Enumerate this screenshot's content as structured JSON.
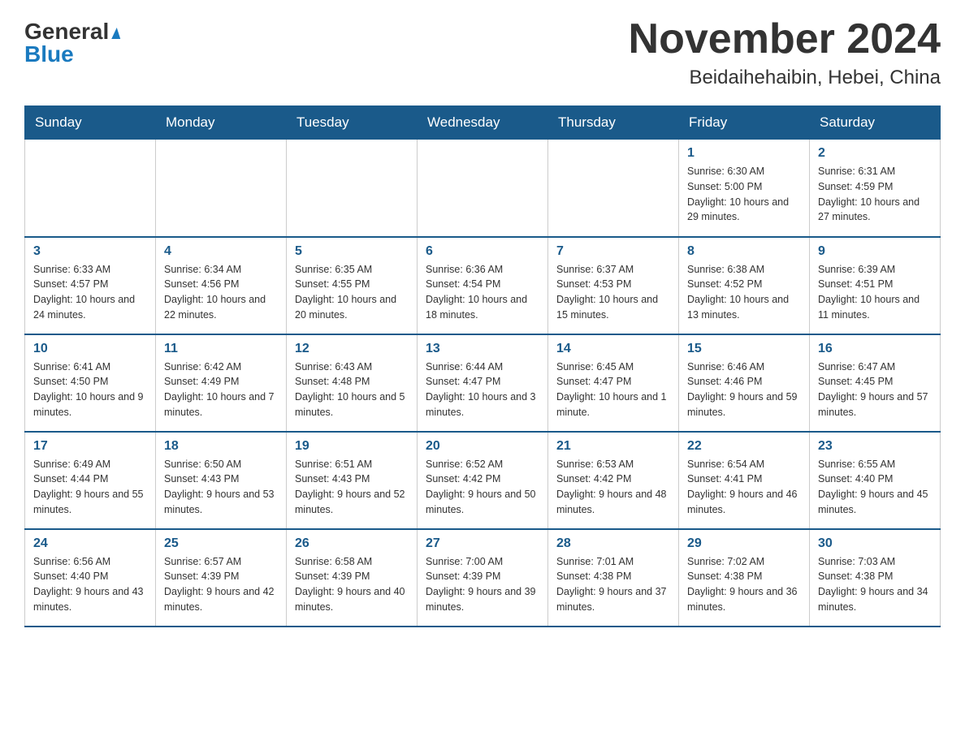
{
  "header": {
    "logo_general": "General",
    "logo_blue": "Blue",
    "month_title": "November 2024",
    "location": "Beidaihehaibin, Hebei, China"
  },
  "weekdays": [
    "Sunday",
    "Monday",
    "Tuesday",
    "Wednesday",
    "Thursday",
    "Friday",
    "Saturday"
  ],
  "weeks": [
    [
      {
        "day": "",
        "info": ""
      },
      {
        "day": "",
        "info": ""
      },
      {
        "day": "",
        "info": ""
      },
      {
        "day": "",
        "info": ""
      },
      {
        "day": "",
        "info": ""
      },
      {
        "day": "1",
        "info": "Sunrise: 6:30 AM\nSunset: 5:00 PM\nDaylight: 10 hours and 29 minutes."
      },
      {
        "day": "2",
        "info": "Sunrise: 6:31 AM\nSunset: 4:59 PM\nDaylight: 10 hours and 27 minutes."
      }
    ],
    [
      {
        "day": "3",
        "info": "Sunrise: 6:33 AM\nSunset: 4:57 PM\nDaylight: 10 hours and 24 minutes."
      },
      {
        "day": "4",
        "info": "Sunrise: 6:34 AM\nSunset: 4:56 PM\nDaylight: 10 hours and 22 minutes."
      },
      {
        "day": "5",
        "info": "Sunrise: 6:35 AM\nSunset: 4:55 PM\nDaylight: 10 hours and 20 minutes."
      },
      {
        "day": "6",
        "info": "Sunrise: 6:36 AM\nSunset: 4:54 PM\nDaylight: 10 hours and 18 minutes."
      },
      {
        "day": "7",
        "info": "Sunrise: 6:37 AM\nSunset: 4:53 PM\nDaylight: 10 hours and 15 minutes."
      },
      {
        "day": "8",
        "info": "Sunrise: 6:38 AM\nSunset: 4:52 PM\nDaylight: 10 hours and 13 minutes."
      },
      {
        "day": "9",
        "info": "Sunrise: 6:39 AM\nSunset: 4:51 PM\nDaylight: 10 hours and 11 minutes."
      }
    ],
    [
      {
        "day": "10",
        "info": "Sunrise: 6:41 AM\nSunset: 4:50 PM\nDaylight: 10 hours and 9 minutes."
      },
      {
        "day": "11",
        "info": "Sunrise: 6:42 AM\nSunset: 4:49 PM\nDaylight: 10 hours and 7 minutes."
      },
      {
        "day": "12",
        "info": "Sunrise: 6:43 AM\nSunset: 4:48 PM\nDaylight: 10 hours and 5 minutes."
      },
      {
        "day": "13",
        "info": "Sunrise: 6:44 AM\nSunset: 4:47 PM\nDaylight: 10 hours and 3 minutes."
      },
      {
        "day": "14",
        "info": "Sunrise: 6:45 AM\nSunset: 4:47 PM\nDaylight: 10 hours and 1 minute."
      },
      {
        "day": "15",
        "info": "Sunrise: 6:46 AM\nSunset: 4:46 PM\nDaylight: 9 hours and 59 minutes."
      },
      {
        "day": "16",
        "info": "Sunrise: 6:47 AM\nSunset: 4:45 PM\nDaylight: 9 hours and 57 minutes."
      }
    ],
    [
      {
        "day": "17",
        "info": "Sunrise: 6:49 AM\nSunset: 4:44 PM\nDaylight: 9 hours and 55 minutes."
      },
      {
        "day": "18",
        "info": "Sunrise: 6:50 AM\nSunset: 4:43 PM\nDaylight: 9 hours and 53 minutes."
      },
      {
        "day": "19",
        "info": "Sunrise: 6:51 AM\nSunset: 4:43 PM\nDaylight: 9 hours and 52 minutes."
      },
      {
        "day": "20",
        "info": "Sunrise: 6:52 AM\nSunset: 4:42 PM\nDaylight: 9 hours and 50 minutes."
      },
      {
        "day": "21",
        "info": "Sunrise: 6:53 AM\nSunset: 4:42 PM\nDaylight: 9 hours and 48 minutes."
      },
      {
        "day": "22",
        "info": "Sunrise: 6:54 AM\nSunset: 4:41 PM\nDaylight: 9 hours and 46 minutes."
      },
      {
        "day": "23",
        "info": "Sunrise: 6:55 AM\nSunset: 4:40 PM\nDaylight: 9 hours and 45 minutes."
      }
    ],
    [
      {
        "day": "24",
        "info": "Sunrise: 6:56 AM\nSunset: 4:40 PM\nDaylight: 9 hours and 43 minutes."
      },
      {
        "day": "25",
        "info": "Sunrise: 6:57 AM\nSunset: 4:39 PM\nDaylight: 9 hours and 42 minutes."
      },
      {
        "day": "26",
        "info": "Sunrise: 6:58 AM\nSunset: 4:39 PM\nDaylight: 9 hours and 40 minutes."
      },
      {
        "day": "27",
        "info": "Sunrise: 7:00 AM\nSunset: 4:39 PM\nDaylight: 9 hours and 39 minutes."
      },
      {
        "day": "28",
        "info": "Sunrise: 7:01 AM\nSunset: 4:38 PM\nDaylight: 9 hours and 37 minutes."
      },
      {
        "day": "29",
        "info": "Sunrise: 7:02 AM\nSunset: 4:38 PM\nDaylight: 9 hours and 36 minutes."
      },
      {
        "day": "30",
        "info": "Sunrise: 7:03 AM\nSunset: 4:38 PM\nDaylight: 9 hours and 34 minutes."
      }
    ]
  ]
}
